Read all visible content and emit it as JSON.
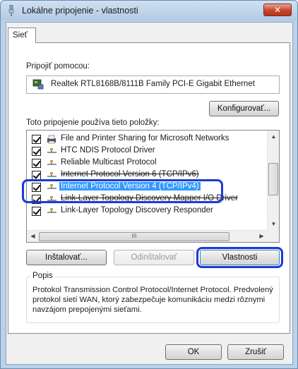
{
  "window": {
    "title": "Lokálne pripojenie - vlastnosti",
    "close_label": "✕"
  },
  "tabs": [
    {
      "label": "Sieť"
    }
  ],
  "connect_using": {
    "label": "Pripojiť pomocou:",
    "adapter_name": "Realtek RTL8168B/8111B Family PCI-E Gigabit Ethernet",
    "adapter_icon": "network-adapter-icon",
    "configure_button": "Konfigurovať..."
  },
  "items_section": {
    "label": "Toto pripojenie používa tieto položky:",
    "items": [
      {
        "label": "File and Printer Sharing for Microsoft Networks",
        "checked": true,
        "icon": "printer-sharing-icon"
      },
      {
        "label": "HTC NDIS Protocol Driver",
        "checked": true,
        "icon": "protocol-icon"
      },
      {
        "label": "Reliable Multicast Protocol",
        "checked": true,
        "icon": "protocol-icon"
      },
      {
        "label": "Internet Protocol Version 6 (TCP/IPv6)",
        "checked": true,
        "icon": "protocol-icon"
      },
      {
        "label": "Internet Protocol Version 4 (TCP/IPv4)",
        "checked": true,
        "icon": "protocol-icon",
        "selected": true
      },
      {
        "label": "Link-Layer Topology Discovery Mapper I/O Driver",
        "checked": true,
        "icon": "protocol-icon"
      },
      {
        "label": "Link-Layer Topology Discovery Responder",
        "checked": true,
        "icon": "protocol-icon"
      }
    ],
    "scroll_grip": "III"
  },
  "buttons": {
    "install": "Inštalovať...",
    "uninstall": "Odinštalovať",
    "properties": "Vlastnosti",
    "ok": "OK",
    "cancel": "Zrušiť"
  },
  "description": {
    "title": "Popis",
    "text": "Protokol Transmission Control Protocol/Internet Protocol. Predvolený protokol sietí WAN, ktorý zabezpečuje komunikáciu medzi rôznymi navzájom prepojenými sieťami."
  },
  "colors": {
    "selection": "#3399ff",
    "annotation": "#1a3bd6",
    "close_button": "#c7442a"
  }
}
